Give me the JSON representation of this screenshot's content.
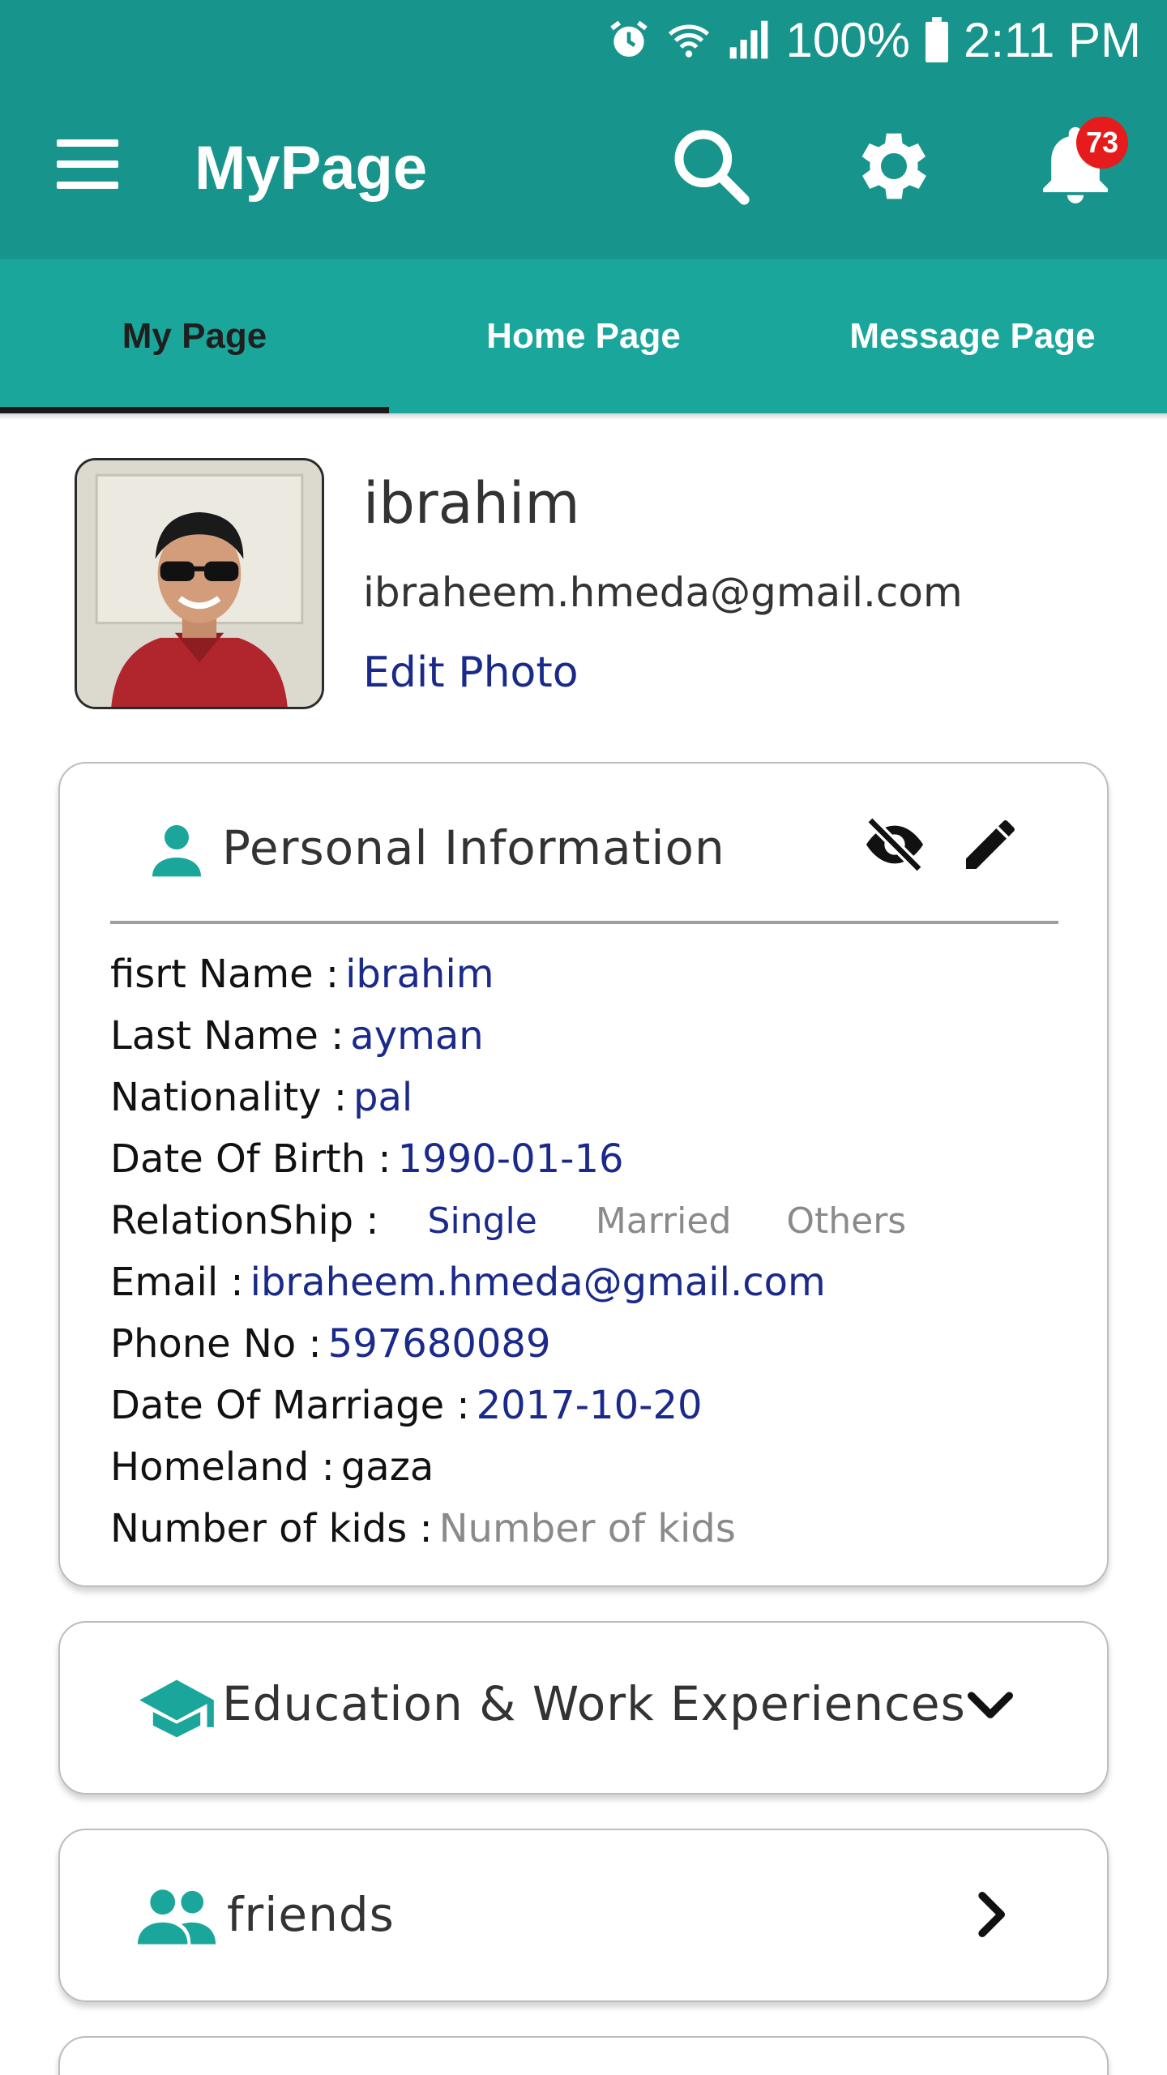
{
  "status_bar": {
    "battery": "100%",
    "time": "2:11 PM"
  },
  "app_bar": {
    "title": "MyPage",
    "notifications_count": "73"
  },
  "tabs": [
    {
      "label": "My Page",
      "active": true
    },
    {
      "label": "Home Page",
      "active": false
    },
    {
      "label": "Message Page",
      "active": false
    }
  ],
  "profile": {
    "name": "ibrahim",
    "email": "ibraheem.hmeda@gmail.com",
    "edit_photo": "Edit Photo"
  },
  "personal_info": {
    "title": "Personal Information",
    "rows": {
      "first_name": {
        "label": "fisrt Name :",
        "value": "ibrahim"
      },
      "last_name": {
        "label": "Last Name :",
        "value": "ayman"
      },
      "nationality": {
        "label": "Nationality :",
        "value": "pal"
      },
      "dob": {
        "label": "Date Of Birth :",
        "value": "1990-01-16"
      },
      "relationship": {
        "label": "RelationShip :",
        "options": [
          "Single",
          "Married",
          "Others"
        ],
        "selected": "Single"
      },
      "email": {
        "label": "Email :",
        "value": "ibraheem.hmeda@gmail.com"
      },
      "phone": {
        "label": "Phone No :",
        "value": "597680089"
      },
      "marriage": {
        "label": "Date Of Marriage :",
        "value": "2017-10-20"
      },
      "homeland": {
        "label": "Homeland :",
        "value": "gaza"
      },
      "kids": {
        "label": "Number of kids :",
        "placeholder": "Number of kids"
      }
    }
  },
  "education": {
    "title": "Education & Work Experiences"
  },
  "friends": {
    "title": "friends"
  },
  "colors": {
    "primary": "#17948b",
    "tabs": "#1ba69c",
    "accent_text": "#1a2a8a",
    "badge": "#e61b1b"
  }
}
